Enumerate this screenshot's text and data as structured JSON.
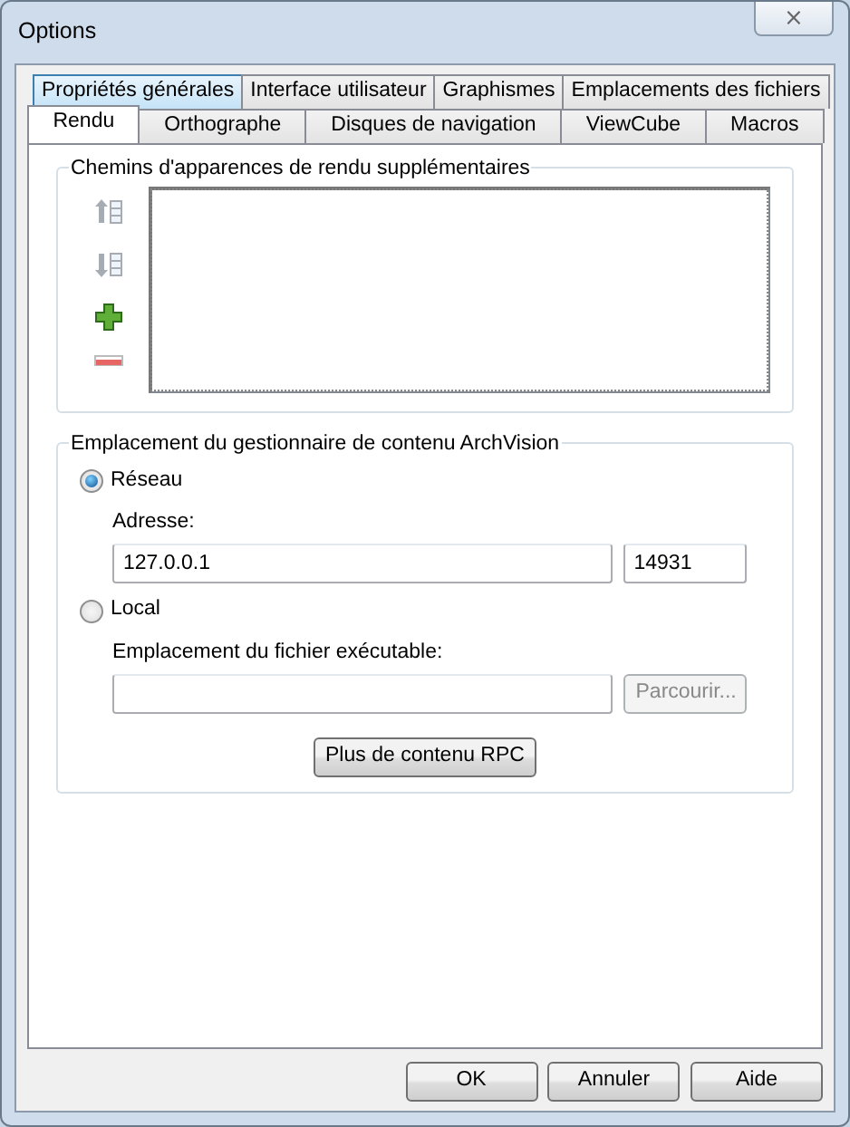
{
  "window": {
    "title": "Options",
    "close_glyph": "⨯"
  },
  "tab_rows": [
    {
      "tabs": [
        {
          "label": "Propriétés générales",
          "selected": false,
          "hot": true
        },
        {
          "label": "Interface utilisateur",
          "selected": false,
          "hot": false
        },
        {
          "label": "Graphismes",
          "selected": false,
          "hot": false
        },
        {
          "label": "Emplacements des fichiers",
          "selected": false,
          "hot": false
        }
      ]
    },
    {
      "tabs": [
        {
          "label": "Rendu",
          "selected": true,
          "hot": false
        },
        {
          "label": "Orthographe",
          "selected": false,
          "hot": false
        },
        {
          "label": "Disques de navigation",
          "selected": false,
          "hot": false
        },
        {
          "label": "ViewCube",
          "selected": false,
          "hot": false
        },
        {
          "label": "Macros",
          "selected": false,
          "hot": false
        }
      ]
    }
  ],
  "paths_group": {
    "title": "Chemins d'apparences de rendu supplémentaires",
    "tools": [
      {
        "kind": "move-up",
        "disabled": true
      },
      {
        "kind": "move-down",
        "disabled": true
      },
      {
        "kind": "add",
        "disabled": false
      },
      {
        "kind": "remove",
        "disabled": false
      }
    ]
  },
  "archvision_group": {
    "title": "Emplacement du gestionnaire de contenu ArchVision",
    "network": {
      "label": "Réseau",
      "selected": true,
      "address_label": "Adresse:",
      "address": "127.0.0.1",
      "port": "14931"
    },
    "local": {
      "label": "Local",
      "selected": false,
      "path_label": "Emplacement du fichier exécutable:",
      "browse": {
        "label": "Parcourir...",
        "disabled": true
      }
    },
    "more_button": "Plus de contenu RPC"
  },
  "buttons": [
    {
      "label": "OK"
    },
    {
      "label": "Annuler"
    },
    {
      "label": "Aide"
    }
  ]
}
